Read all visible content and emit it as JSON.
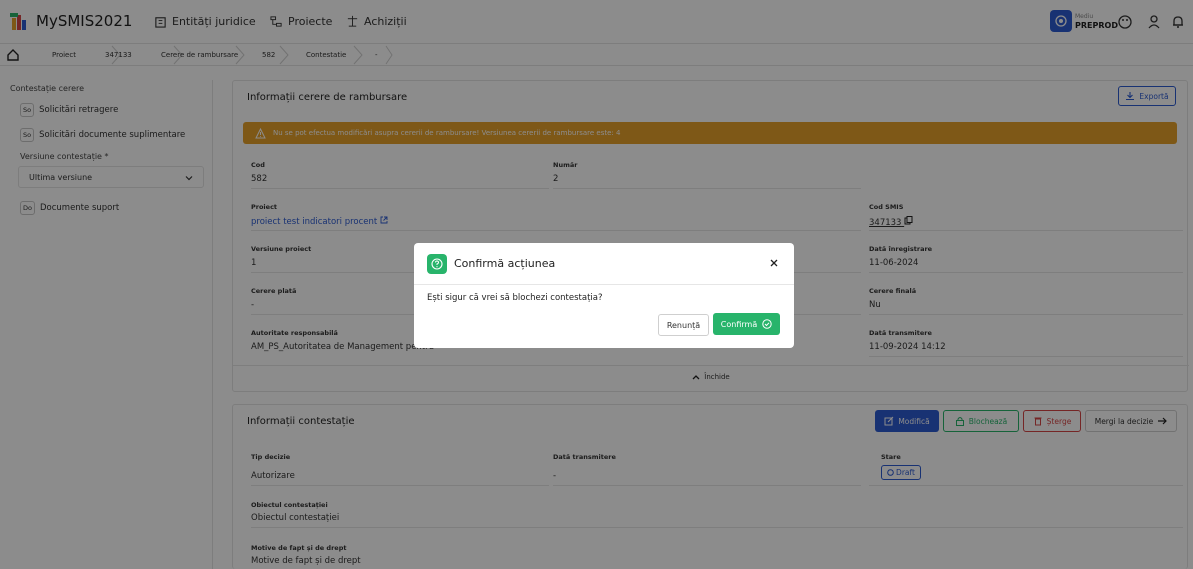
{
  "app": {
    "name": "MySMIS2021"
  },
  "nav": [
    {
      "label": "Entități juridice",
      "icon": "building-icon"
    },
    {
      "label": "Proiecte",
      "icon": "hierarchy-icon"
    },
    {
      "label": "Achiziții",
      "icon": "scale-icon"
    }
  ],
  "env": {
    "small": "Mediu",
    "name": "PREPROD"
  },
  "breadcrumb": [
    "Proiect",
    "347133",
    "Cerere de rambursare",
    "582",
    "Contestatie",
    "-"
  ],
  "sidebar": {
    "title": "Contestație cerere",
    "items": [
      {
        "badge": "So",
        "label": "Solicitări retragere"
      },
      {
        "badge": "So",
        "label": "Solicitări documente suplimentare"
      }
    ],
    "version_label": "Versiune contestație *",
    "version_value": "Ultima versiune",
    "docs": {
      "badge": "Do",
      "label": "Documente suport"
    }
  },
  "reimbursement": {
    "title": "Informații cerere de rambursare",
    "export_label": "Exportă",
    "warning": "Nu se pot efectua modificări asupra cererii de rambursare! Versiunea cererii de rambursare este: 4",
    "fields": {
      "cod_label": "Cod",
      "cod_value": "582",
      "numar_label": "Număr",
      "numar_value": "2",
      "proiect_label": "Proiect",
      "proiect_value": "proiect test indicatori procent",
      "cod_smis_label": "Cod SMIS",
      "cod_smis_value": "347133",
      "versiune_label": "Versiune proiect",
      "versiune_value": "1",
      "data_inreg_label": "Dată înregistrare",
      "data_inreg_value": "11-06-2024",
      "cerere_plata_label": "Cerere plată",
      "cerere_plata_value": "-",
      "cerere_finala_label": "Cerere finală",
      "cerere_finala_value": "Nu",
      "autoritate_label": "Autoritate responsabilă",
      "autoritate_value": "AM_PS_Autoritatea de Management pentru",
      "data_trans_label": "Dată transmitere",
      "data_trans_value": "11-09-2024 14:12"
    },
    "collapse_label": "Închide"
  },
  "contestation": {
    "title": "Informații contestație",
    "buttons": {
      "edit": "Modifică",
      "lock": "Blochează",
      "delete": "Șterge",
      "next": "Mergi la decizie"
    },
    "fields": {
      "tip_label": "Tip decizie",
      "tip_value": "Autorizare",
      "data_label": "Dată transmitere",
      "data_value": "-",
      "stare_label": "Stare",
      "stare_value": "Draft",
      "obiect_label": "Obiectul contestației",
      "obiect_value": "Obiectul contestației",
      "motive_label": "Motive de fapt și de drept",
      "motive_value": "Motive de fapt și de drept"
    }
  },
  "modal": {
    "title": "Confirmă acțiunea",
    "message": "Ești sigur că vrei să blochezi contestația?",
    "cancel": "Renunță",
    "confirm": "Confirmă"
  },
  "colors": {
    "primary": "#2d5bd1",
    "success": "#28b46b",
    "danger": "#d64545",
    "warning": "#e6a12b"
  }
}
